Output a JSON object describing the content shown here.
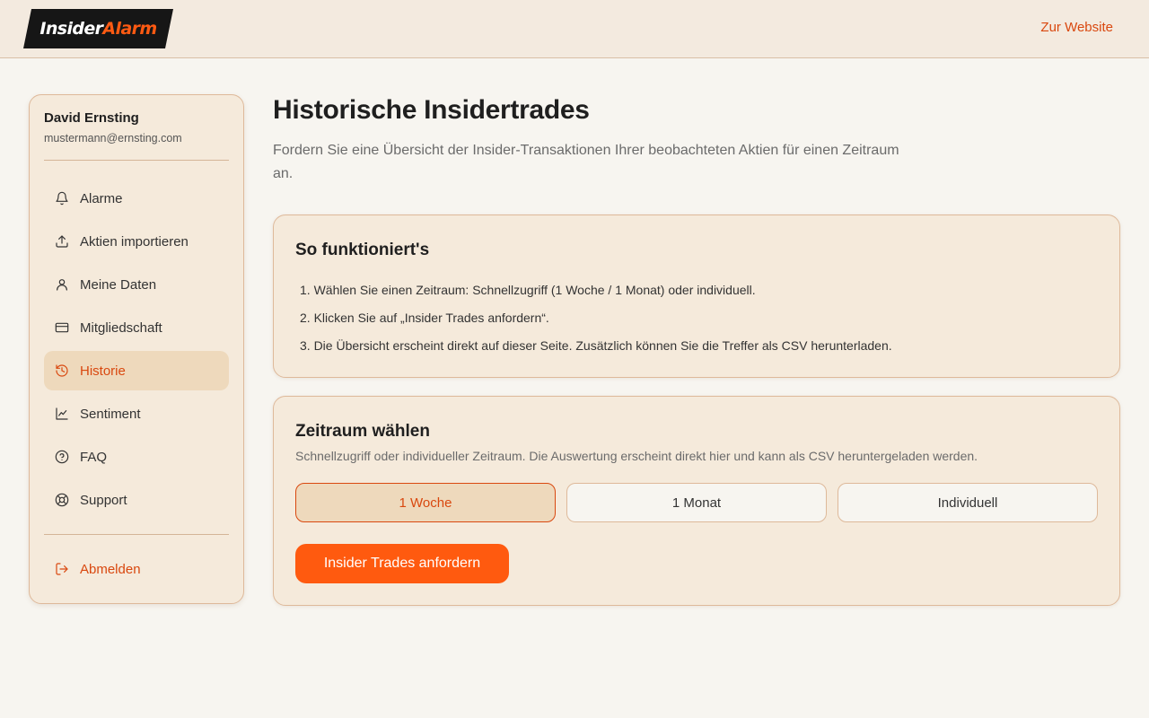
{
  "header": {
    "logo_part1": "Insider",
    "logo_part2": "Alarm",
    "site_link": "Zur Website"
  },
  "user": {
    "name": "David Ernsting",
    "email": "mustermann@ernsting.com"
  },
  "nav": [
    {
      "label": "Alarme",
      "icon": "bell-icon"
    },
    {
      "label": "Aktien importieren",
      "icon": "upload-icon"
    },
    {
      "label": "Meine Daten",
      "icon": "user-icon"
    },
    {
      "label": "Mitgliedschaft",
      "icon": "credit-card-icon"
    },
    {
      "label": "Historie",
      "icon": "history-icon",
      "active": true
    },
    {
      "label": "Sentiment",
      "icon": "line-chart-icon"
    },
    {
      "label": "FAQ",
      "icon": "help-circle-icon"
    },
    {
      "label": "Support",
      "icon": "lifebuoy-icon"
    }
  ],
  "logout": {
    "label": "Abmelden",
    "icon": "logout-icon"
  },
  "page": {
    "title": "Historische Insidertrades",
    "subtitle": "Fordern Sie eine Übersicht der Insider-Transaktionen Ihrer beobachteten Aktien für einen Zeitraum an."
  },
  "how": {
    "title": "So funktioniert's",
    "steps": [
      "1. Wählen Sie einen Zeitraum: Schnellzugriff (1 Woche / 1 Monat) oder individuell.",
      "2. Klicken Sie auf „Insider Trades anfordern“.",
      "3. Die Übersicht erscheint direkt auf dieser Seite. Zusätzlich können Sie die Treffer als CSV herunterladen."
    ]
  },
  "period": {
    "title": "Zeitraum wählen",
    "description": "Schnellzugriff oder individueller Zeitraum. Die Auswertung erscheint direkt hier und kann als CSV heruntergeladen werden.",
    "options": [
      "1 Woche",
      "1 Monat",
      "Individuell"
    ],
    "selected": "1 Woche",
    "submit_label": "Insider Trades anfordern"
  },
  "colors": {
    "accent": "#ff5a0f",
    "accent_text": "#d9480f",
    "panel": "#f5eadb",
    "active_bg": "#eed9bc"
  }
}
